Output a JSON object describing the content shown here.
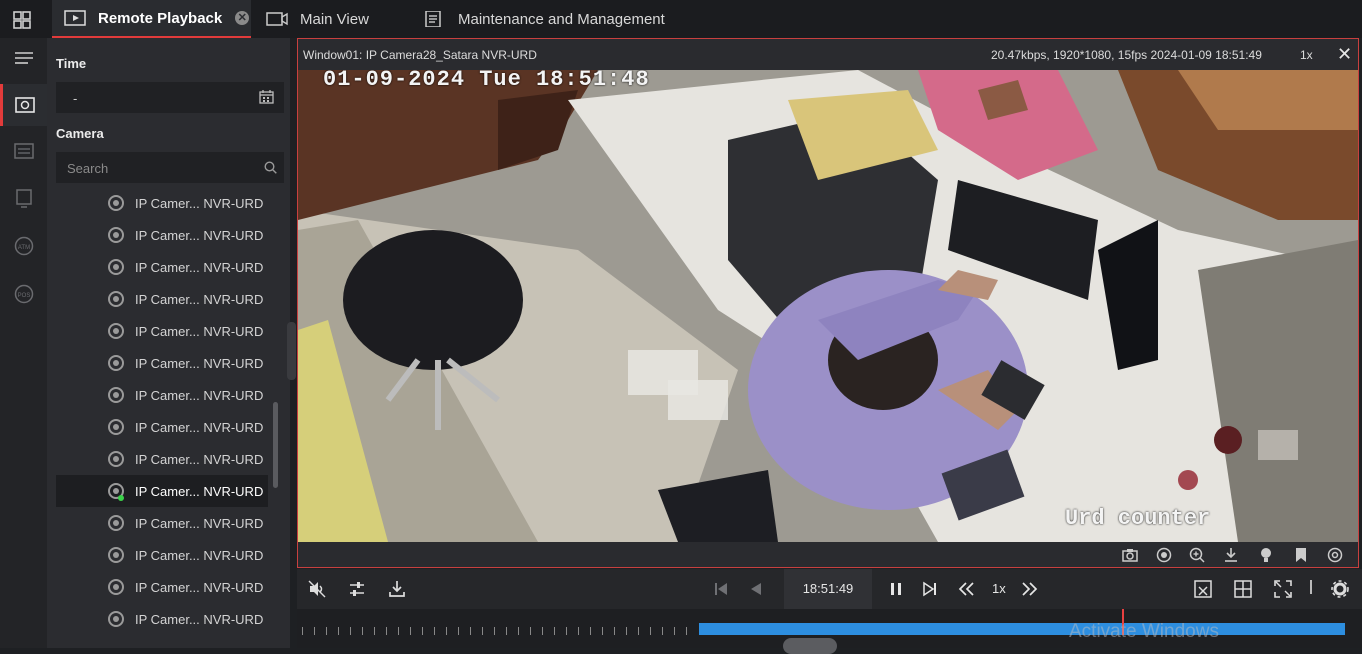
{
  "tabs": [
    {
      "label": "Remote Playback",
      "icon": "playback-icon",
      "active": true
    },
    {
      "label": "Main View",
      "icon": "monitor-icon",
      "active": false
    },
    {
      "label": "Maintenance and Management",
      "icon": "maintenance-icon",
      "active": false
    }
  ],
  "panel": {
    "time_label": "Time",
    "time_value": "-",
    "camera_label": "Camera",
    "search_placeholder": "Search",
    "cameras": [
      "IP Camer... NVR-URD",
      "IP Camer... NVR-URD",
      "IP Camer... NVR-URD",
      "IP Camer... NVR-URD",
      "IP Camer... NVR-URD",
      "IP Camer... NVR-URD",
      "IP Camer... NVR-URD",
      "IP Camer... NVR-URD",
      "IP Camer... NVR-URD",
      "IP Camer... NVR-URD",
      "IP Camer... NVR-URD",
      "IP Camer... NVR-URD",
      "IP Camer... NVR-URD",
      "IP Camer... NVR-URD"
    ],
    "selected_index": 9
  },
  "viewer": {
    "title": "Window01: IP Camera28_Satara NVR-URD",
    "info": "20.47kbps, 1920*1080, 15fps  2024-01-09 18:51:49",
    "speed": "1x",
    "osd_time": "01-09-2024 Tue 18:51:48",
    "osd_label": "Urd counter"
  },
  "controls": {
    "current_time": "18:51:49",
    "speed": "1x"
  },
  "watermark": "Activate Windows",
  "colors": {
    "accent": "#e23b3b",
    "record_bar": "#2d8ee0",
    "online": "#3bd24a"
  }
}
